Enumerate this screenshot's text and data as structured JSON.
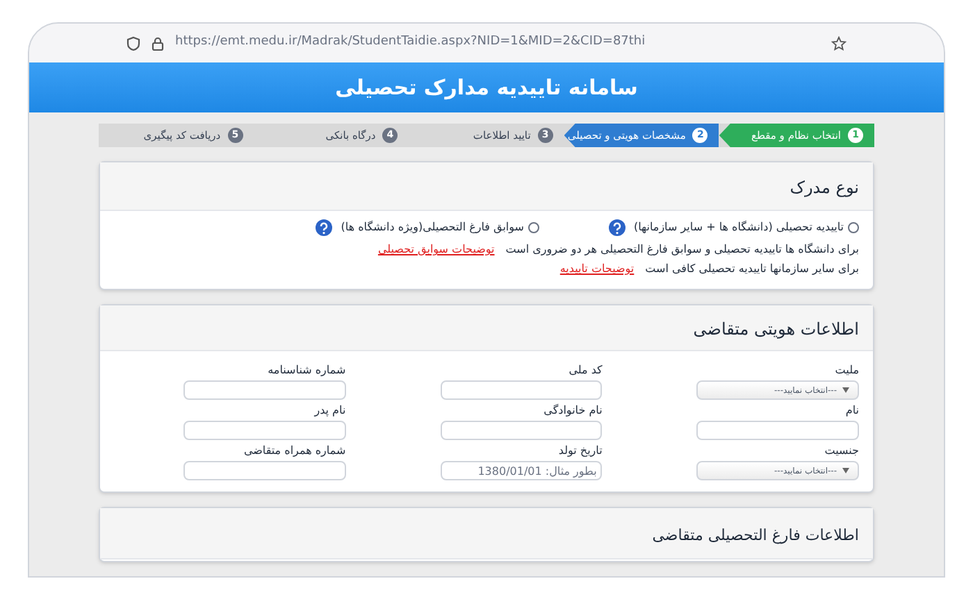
{
  "browser": {
    "url": "https://emt.medu.ir/Madrak/StudentTaidie.aspx?NID=1&MID=2&CID=87thi"
  },
  "header": {
    "title": "سامانه تاییدیه مدارک تحصیلی"
  },
  "steps": [
    {
      "number": "1",
      "label": "انتخاب نظام و مقطع",
      "kind": "done"
    },
    {
      "number": "2",
      "label": "مشخصات هویتی و تحصیلی",
      "kind": "current"
    },
    {
      "number": "3",
      "label": "تایید اطلاعات",
      "kind": "pending"
    },
    {
      "number": "4",
      "label": "درگاه بانکی",
      "kind": "pending"
    },
    {
      "number": "5",
      "label": "دریافت کد پیگیری",
      "kind": "pending"
    }
  ],
  "document_type": {
    "title": "نوع مدرک",
    "options": [
      {
        "label": "تاییدیه تحصیلی (دانشگاه ها + سایر سازمانها)",
        "checked": false
      },
      {
        "label": "سوابق فارغ التحصیلی(ویژه دانشگاه ها)",
        "checked": false
      }
    ],
    "notes": [
      {
        "text": "برای دانشگاه ها تاییدیه تحصیلی و سوابق فارغ التحصیلی هر دو ضروری است",
        "link": "توضیحات سوابق تحصیلی"
      },
      {
        "text": "برای سایر سازمانها تاییدیه تحصیلی کافی است",
        "link": "توضیحات تاییدیه"
      }
    ]
  },
  "identity": {
    "title": "اطلاعات هویتی متقاضی",
    "fields": [
      {
        "label": "ملیت",
        "kind": "select",
        "value": "---انتخاب نمایید---"
      },
      {
        "label": "کد ملی",
        "kind": "text"
      },
      {
        "label": "شماره شناسنامه",
        "kind": "text"
      },
      {
        "label": "نام",
        "kind": "text"
      },
      {
        "label": "نام خانوادگی",
        "kind": "text"
      },
      {
        "label": "نام پدر",
        "kind": "text"
      },
      {
        "label": "جنسیت",
        "kind": "select",
        "value": "---انتخاب نمایید---"
      },
      {
        "label": "تاریخ تولد",
        "kind": "text",
        "placeholder": "بطور مثال: 1380/01/01"
      },
      {
        "label": "شماره همراه متقاضی",
        "kind": "text"
      }
    ]
  },
  "graduation": {
    "title": "اطلاعات فارغ التحصیلی متقاضی"
  }
}
